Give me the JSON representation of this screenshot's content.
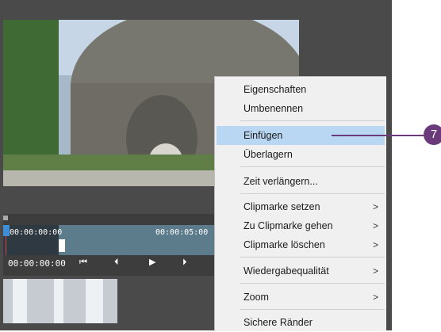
{
  "timeline": {
    "start_timecode": "00:00:00:00",
    "end_timecode": "00:00:05:00",
    "current_timecode": "00:00:00:00",
    "controls": [
      "⏮",
      "⏴",
      "▶",
      "⏵"
    ]
  },
  "context_menu": {
    "items": [
      {
        "label": "Eigenschaften"
      },
      {
        "label": "Umbenennen"
      },
      {
        "label": "Einfügen"
      },
      {
        "label": "Überlagern"
      },
      {
        "label": "Zeit verlängern..."
      },
      {
        "label": "Clipmarke setzen",
        "arrow": ">"
      },
      {
        "label": "Zu Clipmarke gehen",
        "arrow": ">"
      },
      {
        "label": "Clipmarke löschen",
        "arrow": ">"
      },
      {
        "label": "Wiedergabequalität",
        "arrow": ">"
      },
      {
        "label": "Zoom",
        "arrow": ">"
      },
      {
        "label": "Sichere Ränder"
      }
    ]
  },
  "callout": {
    "number": "7"
  },
  "colors": {
    "accent": "#6b3a7a",
    "menu_highlight": "#b9d7f3"
  }
}
